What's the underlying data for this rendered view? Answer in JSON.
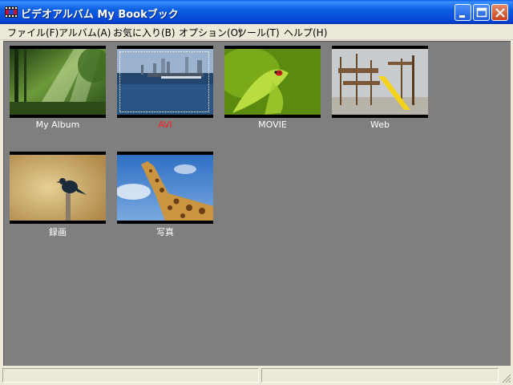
{
  "window": {
    "title": "ビデオアルバム  My Bookブック",
    "controls": {
      "minimize": "minimize",
      "maximize": "maximize",
      "close": "close"
    }
  },
  "menu": [
    {
      "label": "ファイル(F)"
    },
    {
      "label": "アルバム(A)"
    },
    {
      "label": "お気に入り(B)"
    },
    {
      "label": "オプション(O)"
    },
    {
      "label": "ツール(T)"
    },
    {
      "label": "ヘルプ(H)"
    }
  ],
  "albums": [
    {
      "label": "My Album",
      "image": "forest-sunlight",
      "selected": false
    },
    {
      "label": "AVI",
      "image": "harbor-city",
      "selected": true
    },
    {
      "label": "MOVIE",
      "image": "ladybug-leaf",
      "selected": false
    },
    {
      "label": "Web",
      "image": "playground-slide",
      "selected": false
    },
    {
      "label": "録画",
      "image": "bird-on-post",
      "selected": false
    },
    {
      "label": "写真",
      "image": "giraffe-sky",
      "selected": false
    }
  ],
  "colors": {
    "titlebar": "#0c5fe0",
    "content_bg": "#7f7f7f",
    "selected_label": "#ff2020",
    "label": "#ffffff"
  },
  "statusbar": {
    "left": "",
    "right": ""
  }
}
